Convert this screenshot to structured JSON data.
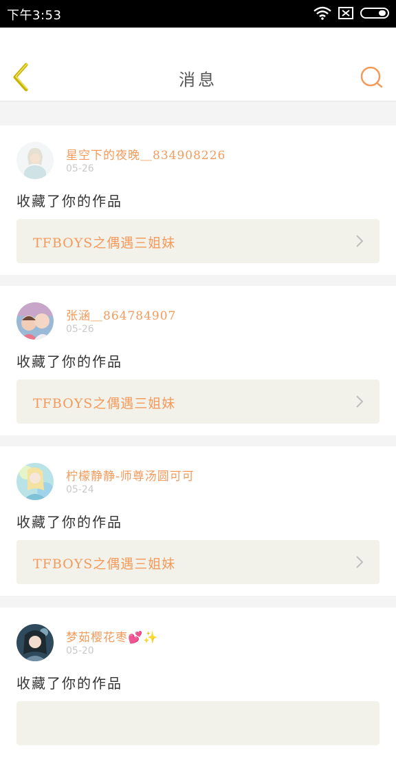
{
  "status_bar": {
    "time": "下午3:53",
    "icons": [
      "wifi-icon",
      "sim-icon",
      "battery-icon"
    ]
  },
  "header": {
    "title": "消息",
    "back_icon": "chevron-left-icon",
    "search_icon": "search-icon"
  },
  "messages": [
    {
      "name": "星空下的夜晚＿834908226",
      "date": "05-26",
      "action": "收藏了你的作品",
      "work": "TFBOYS之偶遇三姐妹"
    },
    {
      "name": "张涵＿864784907",
      "date": "05-26",
      "action": "收藏了你的作品",
      "work": "TFBOYS之偶遇三姐妹"
    },
    {
      "name": "柠檬静静-师尊汤圆可可",
      "date": "05-24",
      "action": "收藏了你的作品",
      "work": "TFBOYS之偶遇三姐妹"
    },
    {
      "name": "梦茹樱花枣💕✨",
      "date": "05-20",
      "action": "收藏了你的作品",
      "work": ""
    }
  ],
  "colors": {
    "accent": "#f49a5b",
    "back_arrow": "#c8b400",
    "card_link_bg": "#f2f1ea"
  }
}
